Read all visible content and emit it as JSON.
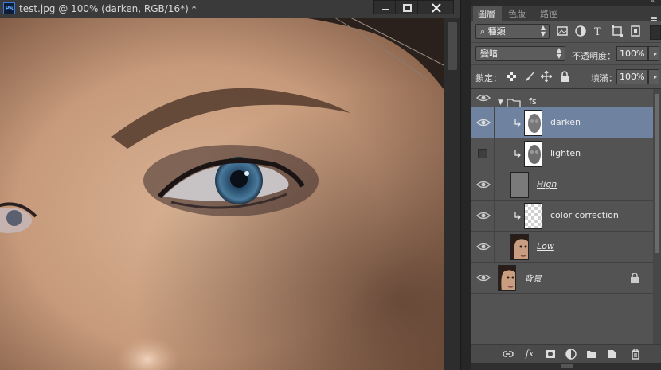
{
  "document": {
    "title": "test.jpg @ 100% (darken, RGB/16*) *",
    "app_icon": "Ps",
    "window_buttons": [
      "minimize-icon",
      "maximize-icon",
      "close-icon"
    ]
  },
  "layers_panel": {
    "tabs": [
      {
        "label": "圖層",
        "active": true
      },
      {
        "label": "色版",
        "active": false
      },
      {
        "label": "路徑",
        "active": false
      }
    ],
    "filter": {
      "kind_label": "種類",
      "icons": [
        "image-filter-icon",
        "adjustment-filter-icon",
        "type-filter-icon",
        "shape-filter-icon",
        "smart-object-filter-icon"
      ]
    },
    "blend_mode": "變暗",
    "opacity_label": "不透明度：",
    "opacity_value": "100%",
    "lock_label": "鎖定：",
    "lock_icons": [
      "lock-transparent-icon",
      "lock-paint-icon",
      "lock-position-icon",
      "lock-all-icon"
    ],
    "fill_label": "填滿：",
    "fill_value": "100%",
    "layers": [
      {
        "name": "fs",
        "type": "group",
        "visible": true,
        "selected": false
      },
      {
        "name": "darken",
        "type": "clipped-mask",
        "visible": true,
        "selected": true
      },
      {
        "name": "lighten",
        "type": "clipped-mask",
        "visible": false,
        "selected": false
      },
      {
        "name": "High",
        "type": "pixel",
        "visible": true,
        "selected": false
      },
      {
        "name": "color correction",
        "type": "clipped-transparent",
        "visible": true,
        "selected": false
      },
      {
        "name": "Low",
        "type": "pixel",
        "visible": true,
        "selected": false
      },
      {
        "name": "背景",
        "type": "background",
        "visible": true,
        "selected": false,
        "locked": true
      }
    ],
    "footer_buttons": [
      "link-layers-icon",
      "fx-icon",
      "add-mask-icon",
      "adjustment-layer-icon",
      "new-group-icon",
      "new-layer-icon",
      "trash-icon"
    ],
    "footer_fx_label": "fx"
  }
}
